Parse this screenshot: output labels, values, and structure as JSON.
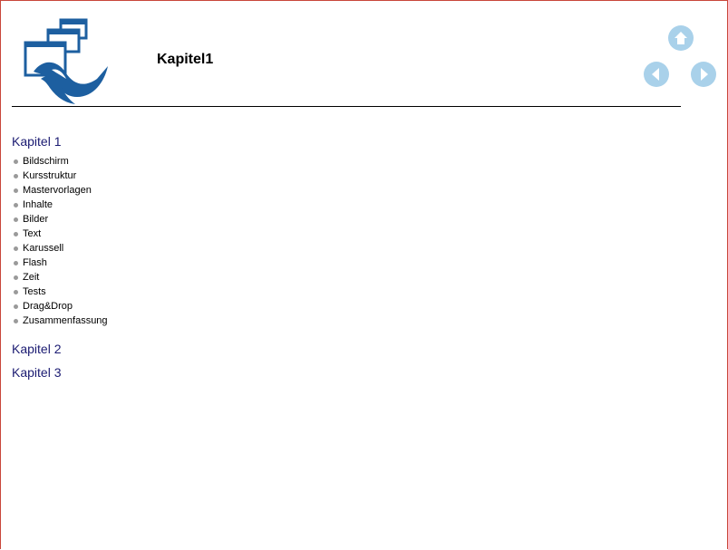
{
  "header": {
    "title": "Kapitel1",
    "logo_icon": "windows-wave-logo",
    "nav": {
      "home_icon": "home-arrow-icon",
      "prev_icon": "arrow-left-icon",
      "next_icon": "arrow-right-icon"
    }
  },
  "toc": {
    "chapters": [
      {
        "title": "Kapitel 1",
        "items": [
          "Bildschirm",
          "Kursstruktur",
          "Mastervorlagen",
          "Inhalte",
          "Bilder",
          "Text",
          "Karussell",
          "Flash",
          "Zeit",
          "Tests",
          "Drag&Drop",
          "Zusammenfassung"
        ]
      },
      {
        "title": "Kapitel 2"
      },
      {
        "title": "Kapitel 3"
      }
    ]
  },
  "colors": {
    "heading": "#1b1b72",
    "nav_button": "#a9d1ea",
    "frame_border": "#c9473b",
    "logo_blue": "#1d5fa0"
  }
}
